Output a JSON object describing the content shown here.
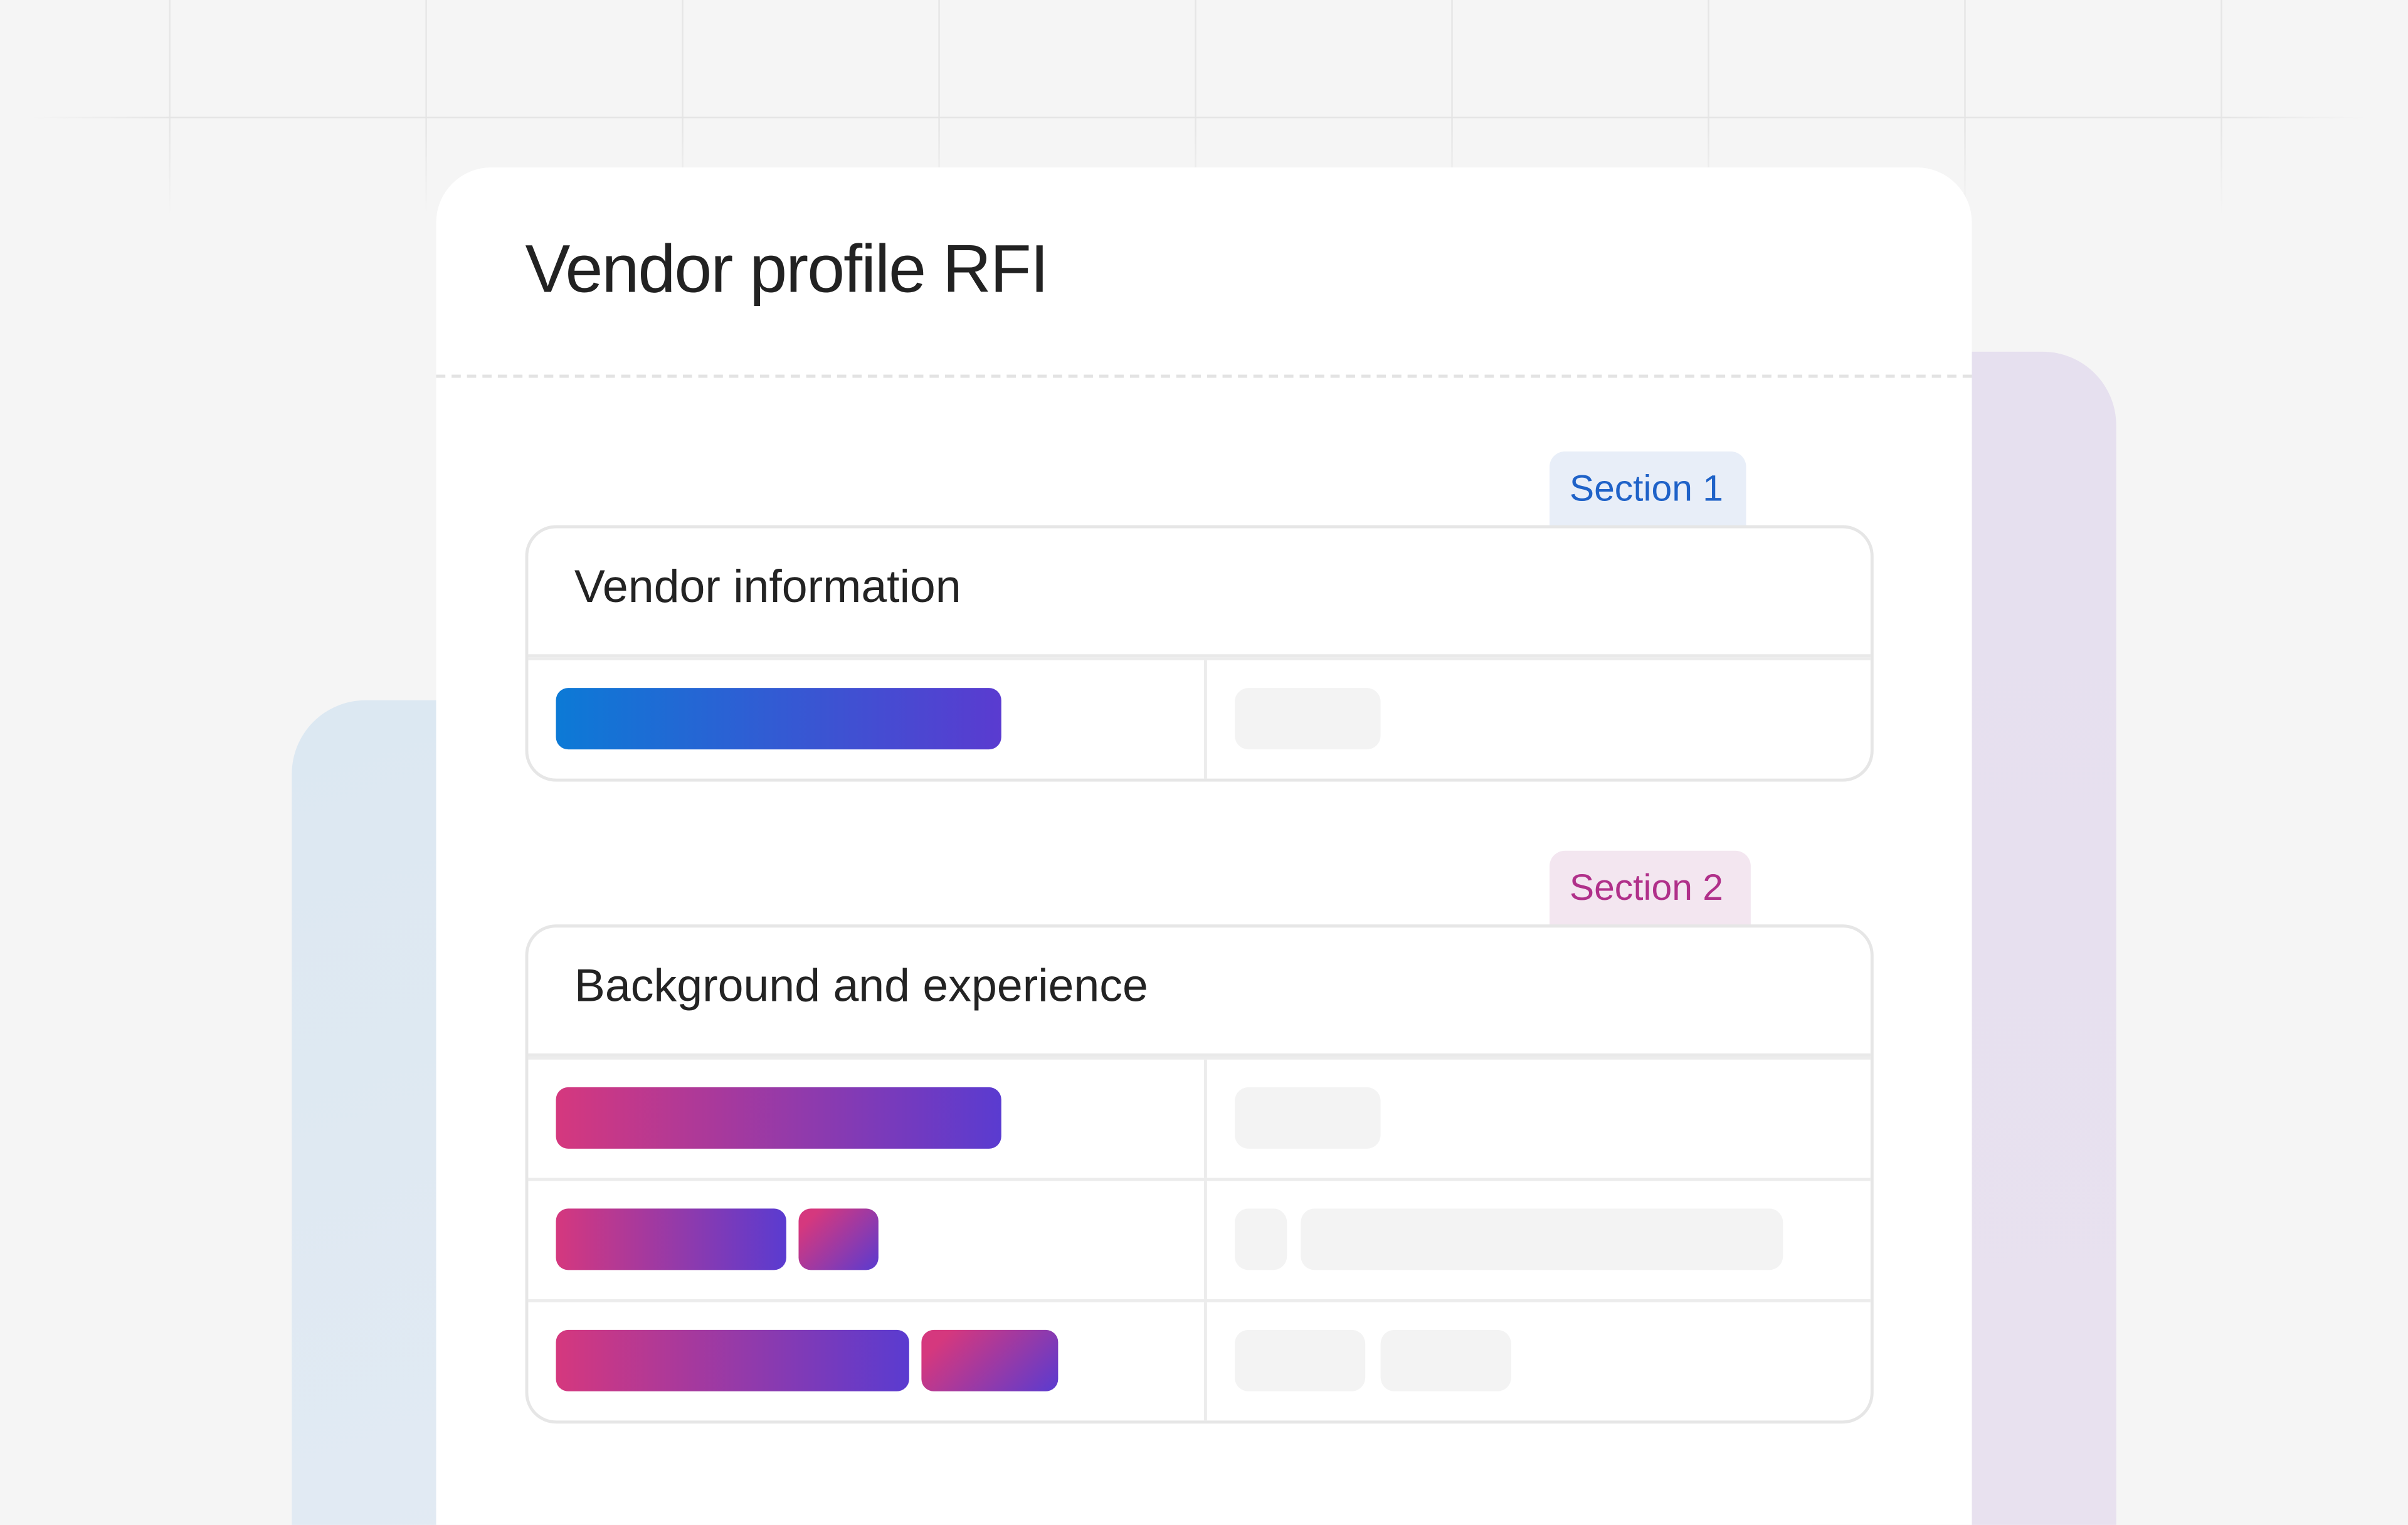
{
  "card": {
    "title": "Vendor profile RFI"
  },
  "sections": [
    {
      "tag": "Section 1",
      "title": "Vendor information",
      "accent": "#1f62c8"
    },
    {
      "tag": "Section 2",
      "title": "Background and experience",
      "accent": "#b0308a"
    }
  ],
  "colors": {
    "blue_gradient": [
      "#0c7ad6",
      "#5a3bd0"
    ],
    "magenta_gradient": [
      "#d5387e",
      "#5a3bd0"
    ]
  }
}
